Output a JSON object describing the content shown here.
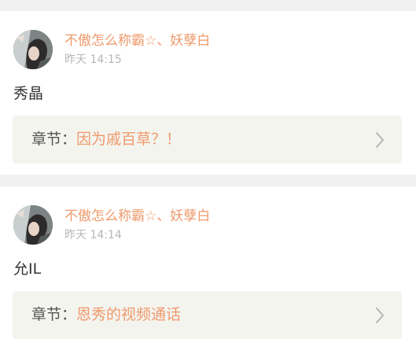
{
  "comments": [
    {
      "username": "不傲怎么称霸☆、妖孽白",
      "time": "昨天 14:15",
      "text": "秀晶",
      "chapter_prefix": "章节：",
      "chapter_title": "因为戚百草？！"
    },
    {
      "username": "不傲怎么称霸☆、妖孽白",
      "time": "昨天 14:14",
      "text": "允IL",
      "chapter_prefix": "章节：",
      "chapter_title": "恩秀的视频通话"
    }
  ],
  "icons": {
    "avatar": "user-avatar-photo",
    "chevron": "chevron-right-icon"
  },
  "colors": {
    "accent": "#ee9a6c",
    "muted": "#b7b7b7",
    "text": "#333333",
    "chapter_bg": "#f4f4ef",
    "page_bg": "#f1f1f1"
  }
}
